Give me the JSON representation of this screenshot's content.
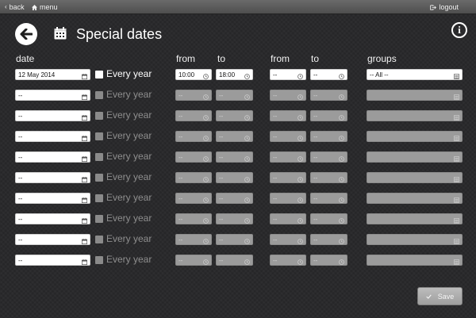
{
  "nav": {
    "back": "back",
    "menu": "menu",
    "logout": "logout"
  },
  "page": {
    "title": "Special dates"
  },
  "columns": {
    "date": "date",
    "from1": "from",
    "to1": "to",
    "from2": "from",
    "to2": "to",
    "groups": "groups"
  },
  "every_year_label": "Every year",
  "rows": [
    {
      "date": "12 May 2014",
      "from1": "10:00",
      "to1": "18:00",
      "from2": "--",
      "to2": "--",
      "group": "-- All --",
      "enabled": true
    },
    {
      "date": "--",
      "from1": "--",
      "to1": "--",
      "from2": "--",
      "to2": "--",
      "group": "",
      "enabled": false
    },
    {
      "date": "--",
      "from1": "--",
      "to1": "--",
      "from2": "--",
      "to2": "--",
      "group": "",
      "enabled": false
    },
    {
      "date": "--",
      "from1": "--",
      "to1": "--",
      "from2": "--",
      "to2": "--",
      "group": "",
      "enabled": false
    },
    {
      "date": "--",
      "from1": "--",
      "to1": "--",
      "from2": "--",
      "to2": "--",
      "group": "",
      "enabled": false
    },
    {
      "date": "--",
      "from1": "--",
      "to1": "--",
      "from2": "--",
      "to2": "--",
      "group": "",
      "enabled": false
    },
    {
      "date": "--",
      "from1": "--",
      "to1": "--",
      "from2": "--",
      "to2": "--",
      "group": "",
      "enabled": false
    },
    {
      "date": "--",
      "from1": "--",
      "to1": "--",
      "from2": "--",
      "to2": "--",
      "group": "",
      "enabled": false
    },
    {
      "date": "--",
      "from1": "--",
      "to1": "--",
      "from2": "--",
      "to2": "--",
      "group": "",
      "enabled": false
    },
    {
      "date": "--",
      "from1": "--",
      "to1": "--",
      "from2": "--",
      "to2": "--",
      "group": "",
      "enabled": false
    }
  ],
  "save_label": "Save",
  "icons": {
    "back": "arrow-left-icon",
    "menu": "home-icon",
    "logout": "logout-icon",
    "page": "calendar-icon",
    "info": "info-icon",
    "date": "calendar-icon",
    "time": "clock-icon",
    "groups": "list-icon",
    "save": "check-icon"
  }
}
